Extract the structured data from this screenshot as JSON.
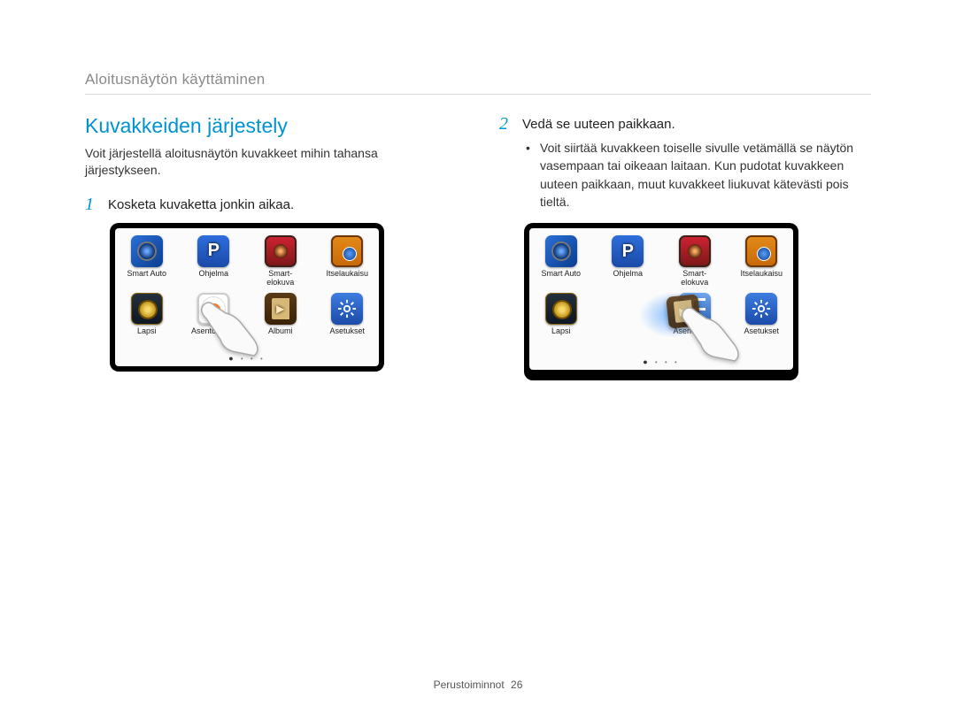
{
  "breadcrumb": "Aloitusnäytön käyttäminen",
  "heading": "Kuvakkeiden järjestely",
  "intro": "Voit järjestellä aloitusnäytön kuvakkeet mihin tahansa järjestykseen.",
  "step1": {
    "num": "1",
    "text": "Kosketa kuvaketta jonkin aikaa."
  },
  "step2": {
    "num": "2",
    "text": "Vedä se uuteen paikkaan."
  },
  "step2_bullet": "Voit siirtää kuvakkeen toiselle sivulle vetämällä se näytön vasempaan tai oikeaan laitaan. Kun pudotat kuvakkeen uuteen paikkaan, muut kuvakkeet liukuvat kätevästi pois tieltä.",
  "screen1": {
    "apps": [
      {
        "label": "Smart Auto"
      },
      {
        "label": "Ohjelma"
      },
      {
        "label": "Smart-elokuva"
      },
      {
        "label": "Itselaukaisu"
      },
      {
        "label": "Lapsi"
      },
      {
        "label": "Asento-opas"
      },
      {
        "label": "Albumi"
      },
      {
        "label": "Asetukset"
      }
    ]
  },
  "screen2": {
    "apps": [
      {
        "label": "Smart Auto"
      },
      {
        "label": "Ohjelma"
      },
      {
        "label": "Smart-elokuva"
      },
      {
        "label": "Itselaukaisu"
      },
      {
        "label": "Lapsi"
      },
      {
        "label": ""
      },
      {
        "label": "Asento-op..."
      },
      {
        "label": "Asetukset"
      }
    ]
  },
  "footer": {
    "section": "Perustoiminnot",
    "page": "26"
  }
}
